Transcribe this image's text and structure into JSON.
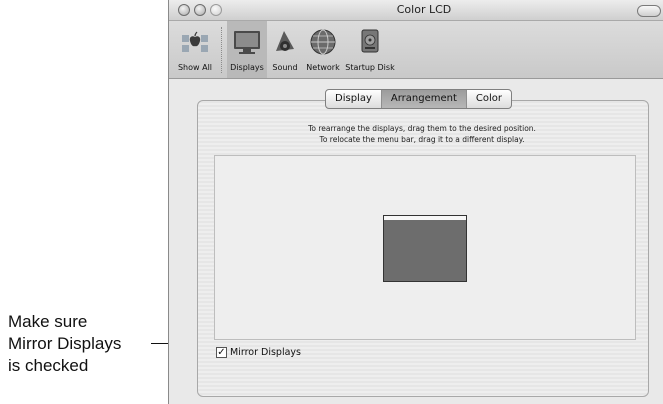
{
  "window": {
    "title": "Color LCD"
  },
  "toolbar": {
    "items": [
      {
        "label": "Show All",
        "icon": "apple-icon"
      },
      {
        "label": "Displays",
        "icon": "display-icon"
      },
      {
        "label": "Sound",
        "icon": "speaker-icon"
      },
      {
        "label": "Network",
        "icon": "globe-icon"
      },
      {
        "label": "Startup Disk",
        "icon": "disk-icon"
      }
    ],
    "selected": "Displays"
  },
  "tabs": [
    {
      "label": "Display"
    },
    {
      "label": "Arrangement"
    },
    {
      "label": "Color"
    }
  ],
  "active_tab": "Arrangement",
  "instructions": {
    "line1": "To rearrange the displays, drag them to the desired position.",
    "line2": "To relocate the menu bar, drag it to a different display."
  },
  "mirror": {
    "label": "Mirror Displays",
    "checked": true
  },
  "callout": {
    "line1": "Make sure",
    "line2": "Mirror Displays",
    "line3": "is checked"
  }
}
